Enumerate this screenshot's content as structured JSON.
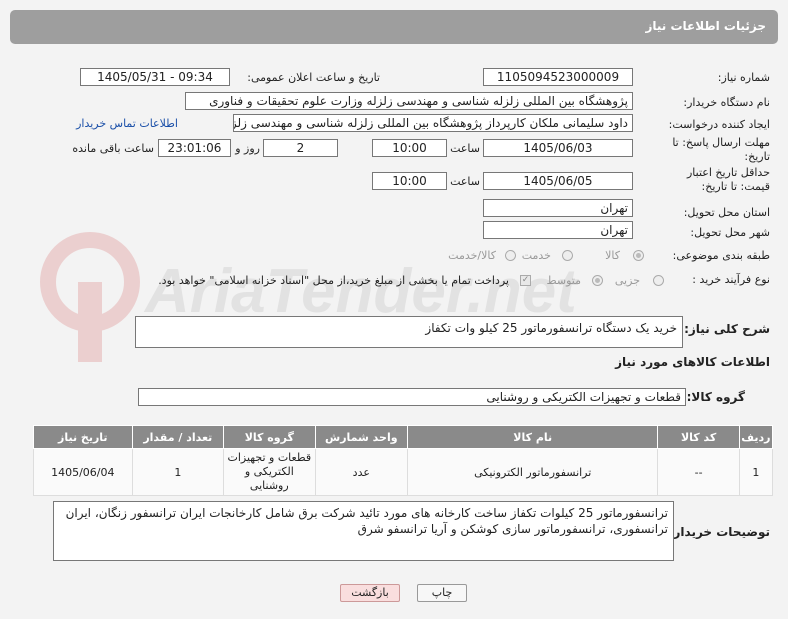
{
  "header": {
    "title": "جزئیات اطلاعات نیاز"
  },
  "form": {
    "need_number_label": "شماره نیاز:",
    "need_number": "1105094523000009",
    "announce_label": "تاریخ و ساعت اعلان عمومی:",
    "announce_value": "1405/05/31 - 09:34",
    "buyer_org_label": "نام دستگاه خریدار:",
    "buyer_org": "پژوهشگاه بین المللی زلزله شناسی و مهندسی زلزله وزارت علوم تحقیقات و فناوری",
    "creator_label": "ایجاد کننده درخواست:",
    "creator": "داود سلیمانی ملکان کارپرداز پژوهشگاه بین المللی زلزله شناسی و مهندسی زلزله",
    "contact_link": "اطلاعات تماس خریدار",
    "deadline_label": "مهلت ارسال پاسخ: تا تاریخ:",
    "deadline_date": "1405/06/03",
    "time_label": "ساعت",
    "deadline_time": "10:00",
    "days_label": "روز و",
    "days": "2",
    "remaining": "23:01:06",
    "remaining_label": "ساعت باقی مانده",
    "validity_label": "حداقل تاریخ اعتبار قیمت: تا تاریخ:",
    "validity_date": "1405/06/05",
    "validity_time": "10:00",
    "province_label": "استان محل تحویل:",
    "province": "تهران",
    "city_label": "شهر محل تحویل:",
    "city": "تهران",
    "category_label": "طبقه بندی موضوعی:",
    "category_options": [
      "کالا",
      "خدمت",
      "کالا/خدمت"
    ],
    "process_label": "نوع فرآیند خرید :",
    "process_options": [
      "جزیی",
      "متوسط"
    ],
    "payment_note": "پرداخت تمام یا بخشی از مبلغ خرید،از محل \"اسناد خزانه اسلامی\" خواهد بود."
  },
  "summary": {
    "label": "شرح کلی نیاز:",
    "value": "خرید یک دستگاه ترانسفورماتور 25 کیلو وات تکفاز"
  },
  "goods_info": {
    "title": "اطلاعات کالاهای مورد نیاز",
    "group_label": "گروه کالا:",
    "group_value": "قطعات و تجهیزات الکتریکی و روشنایی"
  },
  "table": {
    "headers": [
      "ردیف",
      "کد کالا",
      "نام کالا",
      "واحد شمارش",
      "گروه کالا",
      "تعداد / مقدار",
      "تاریخ نیاز"
    ],
    "rows": [
      [
        "1",
        "--",
        "ترانسفورماتور الکترونیکی",
        "عدد",
        "قطعات و تجهیزات الکتریکی و روشنایی",
        "1",
        "1405/06/04"
      ]
    ]
  },
  "buyer_notes": {
    "label": "توضیحات خریدار:",
    "value": "ترانسفورماتور 25 کیلوات تکفاز ساخت کارخانه های مورد تائید شرکت برق شامل کارخانجات ایران ترانسفور زنگان، ایران ترانسفوری، ترانسفورماتور سازی کوشکن و آریا ترانسفو شرق"
  },
  "buttons": {
    "print": "چاپ",
    "back": "بازگشت"
  },
  "watermark": {
    "text": "AriaTender.net"
  },
  "colors": {
    "header": "#9e9e9e",
    "table_header": "#8a8a8a",
    "link": "#1a4fa8",
    "back_button": "#f9dede"
  }
}
